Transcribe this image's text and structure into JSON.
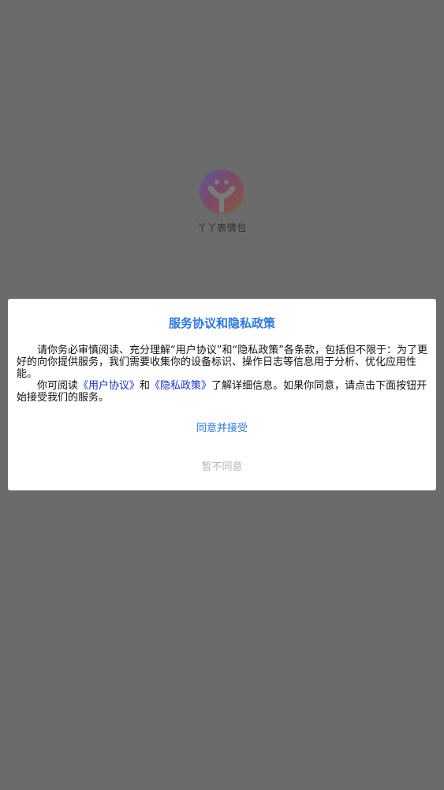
{
  "splash": {
    "app_name": "丫丫表情包",
    "logo_icon": "smile-face-logo"
  },
  "dialog": {
    "title": "服务协议和隐私政策",
    "paragraph1": "请你务必审慎阅读、充分理解“用户协议”和“隐私政策”各条款，包括但不限于：为了更好的向你提供服务，我们需要收集你的设备标识、操作日志等信息用于分析、优化应用性能。",
    "paragraph2_prefix": "你可阅读",
    "user_agreement_link": "《用户协议》",
    "paragraph2_and": "和",
    "privacy_policy_link": "《隐私政策》",
    "paragraph2_suffix": "了解详细信息。如果你同意，请点击下面按钮开始接受我们的服务。",
    "agree_button": "同意并接受",
    "decline_button": "暂不同意"
  },
  "colors": {
    "accent": "#2a78e4",
    "link": "#1a33d6",
    "disabled": "#b5b5b5",
    "overlay": "#6b6b6b"
  }
}
